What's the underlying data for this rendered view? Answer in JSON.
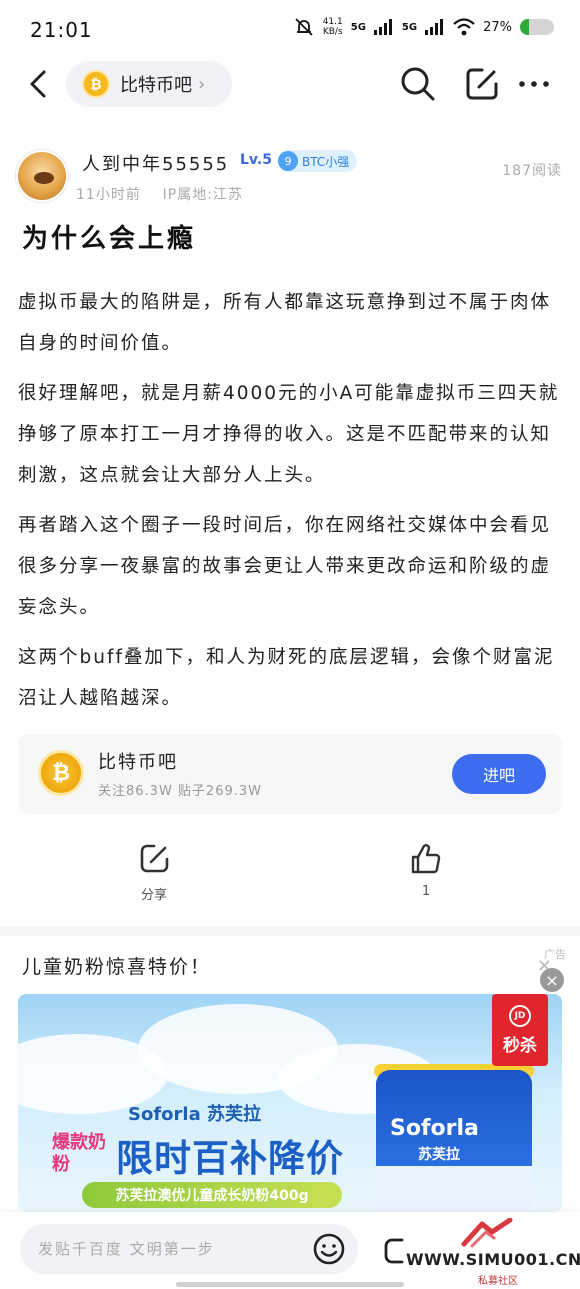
{
  "status_bar": {
    "time": "21:01",
    "net_speed_value": "41.1",
    "net_speed_unit": "KB/s",
    "signal_1": "5G",
    "signal_2": "5G",
    "battery_text": "27%",
    "battery_level": 0.27
  },
  "nav": {
    "forum_label": "比特币吧"
  },
  "author": {
    "name": "人到中年55555",
    "level": "Lv.5",
    "badge_num": "9",
    "badge_text": "BTC小强",
    "time_ago": "11小时前",
    "ip_location": "IP属地:江苏",
    "reads": "187阅读"
  },
  "post": {
    "title": "为什么会上瘾",
    "paragraphs": [
      "虚拟币最大的陷阱是，所有人都靠这玩意挣到过不属于肉体自身的时间价值。",
      "很好理解吧，就是月薪4000元的小A可能靠虚拟币三四天就挣够了原本打工一月才挣得的收入。这是不匹配带来的认知刺激，这点就会让大部分人上头。",
      "再者踏入这个圈子一段时间后，你在网络社交媒体中会看见很多分享一夜暴富的故事会更让人带来更改命运和阶级的虚妄念头。",
      "这两个buff叠加下，和人为财死的底层逻辑，会像个财富泥沼让人越陷越深。"
    ]
  },
  "forum_card": {
    "name": "比特币吧",
    "stats": "关注86.3W  贴子269.3W",
    "enter_label": "进吧"
  },
  "actions": {
    "share_label": "分享",
    "like_count": "1"
  },
  "ad": {
    "title": "儿童奶粉惊喜特价！",
    "label": "广告",
    "brand": "Soforla 苏芙拉",
    "tag": "爆款奶粉",
    "headline": "限时百补降价",
    "product": "苏芙拉澳优儿童成长奶粉400g",
    "can_brand": "Soforla",
    "can_cn": "苏芙拉",
    "jd_logo": "JD",
    "jd_text": "秒杀"
  },
  "bottom": {
    "comment_placeholder": "发贴千百度 文明第一步",
    "watermark": "WWW.SIMU001.CN",
    "watermark_sub": "私募社区"
  }
}
